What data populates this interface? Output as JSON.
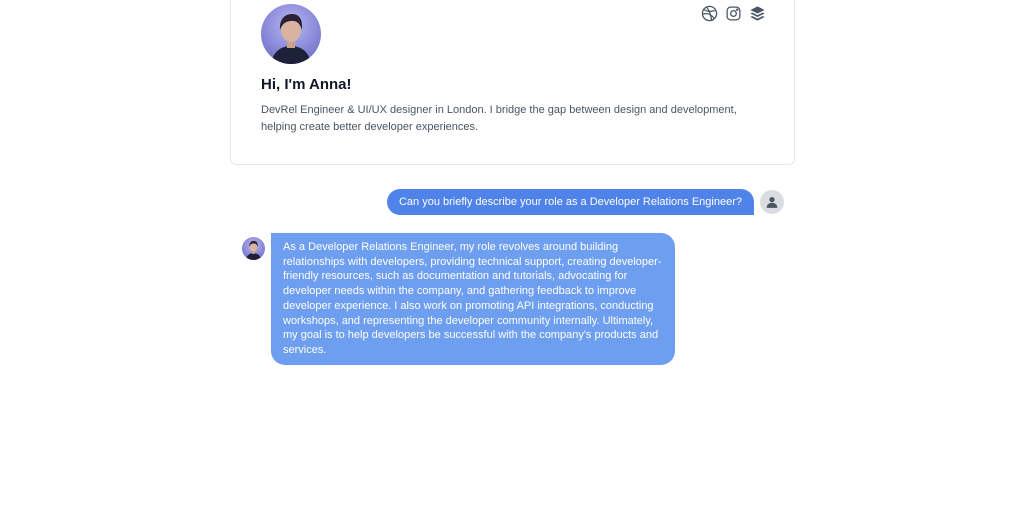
{
  "profile": {
    "greeting": "Hi, I'm Anna!",
    "bio": "DevRel Engineer & UI/UX designer in London. I bridge the gap between design and development, helping create better developer experiences.",
    "social_icons": [
      "dribbble-icon",
      "instagram-icon",
      "layers-icon"
    ]
  },
  "chat": {
    "user_message": "Can you briefly describe your role as a Developer Relations Engineer?",
    "bot_message": "As a Developer Relations Engineer, my role revolves around building relationships with developers, providing technical support, creating developer-friendly resources, such as documentation and tutorials, advocating for developer needs within the company, and gathering feedback to improve developer experience. I also work on promoting API integrations, conducting workshops, and representing the developer community internally. Ultimately, my goal is to help developers be successful with the company's products and services."
  },
  "colors": {
    "user_bubble": "#4f83ea",
    "bot_bubble": "#6e9ef0",
    "card_border": "#e5e7eb"
  }
}
